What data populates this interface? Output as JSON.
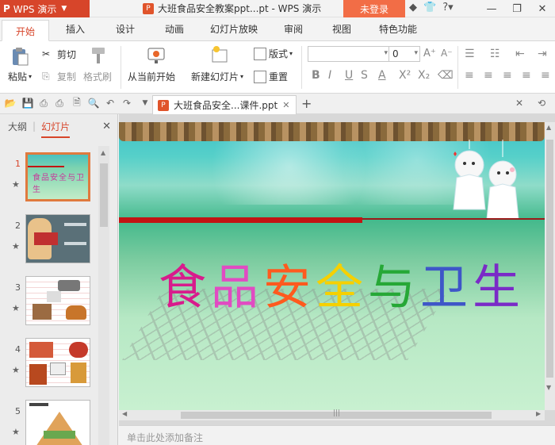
{
  "titlebar": {
    "app_name": "WPS 演示",
    "app_logo": "P",
    "doc_title": "大班食品安全教案ppt...pt - WPS 演示",
    "login": "未登录",
    "icons": [
      "shield-icon",
      "shirt-icon",
      "help-icon",
      "minimize-icon",
      "restore-icon",
      "close-icon"
    ]
  },
  "tabs": [
    "开始",
    "插入",
    "设计",
    "动画",
    "幻灯片放映",
    "审阅",
    "视图",
    "特色功能"
  ],
  "ribbon": {
    "paste": "粘贴",
    "cut": "剪切",
    "copy": "复制",
    "format_painter": "格式刷",
    "from_current": "从当前开始",
    "new_slide": "新建幻灯片",
    "layout": "版式",
    "reset": "重置",
    "font_size": "0"
  },
  "doc_tab": {
    "label": "大班食品安全...课件.ppt"
  },
  "left_panel": {
    "outline_tab": "大纲",
    "slides_tab": "幻灯片",
    "slide_numbers": [
      "1",
      "2",
      "3",
      "4",
      "5"
    ]
  },
  "slide": {
    "title": "食品安全与卫生",
    "colors": [
      "#d81b8c",
      "#e14bc2",
      "#ff5a1e",
      "#f6d000",
      "#26a836",
      "#3e56c8",
      "#7a2bc7"
    ]
  },
  "notes_placeholder": "单击此处添加备注"
}
